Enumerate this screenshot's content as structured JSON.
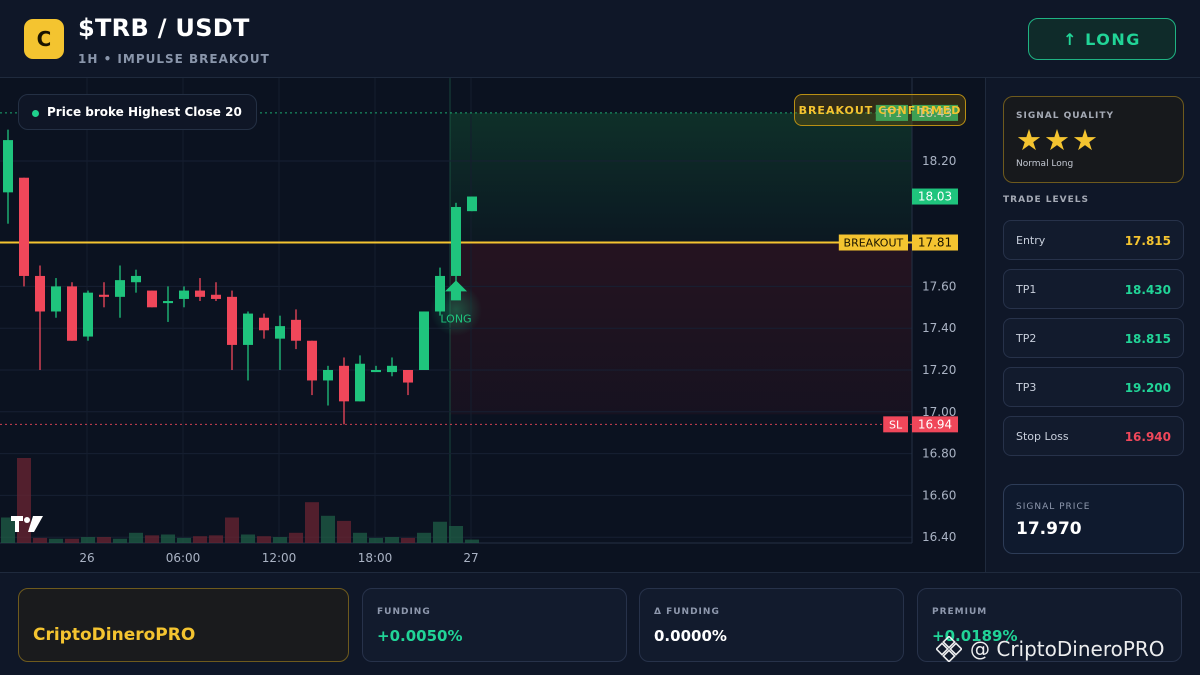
{
  "header": {
    "logo_letter": "C",
    "pair": "$TRB / USDT",
    "subtitle": "1H • IMPULSE BREAKOUT",
    "signal_button": "↑ LONG"
  },
  "chart_overlay": {
    "note": "Price broke Highest Close 20",
    "confirmation": "BREAKOUT CONFIRMED",
    "long_marker_label": "LONG"
  },
  "chart_data": {
    "type": "candlestick",
    "y_ticks": [
      "18.20",
      "17.60",
      "17.40",
      "17.20",
      "17.00",
      "16.80",
      "16.60",
      "16.40"
    ],
    "x_ticks": [
      "26",
      "06:00",
      "12:00",
      "18:00",
      "27"
    ],
    "ylim": [
      16.35,
      18.75
    ],
    "levels": [
      {
        "name": "TP1",
        "value": 18.43,
        "label": "TP1",
        "price_label": "18.43",
        "color": "#1fc47d",
        "style": "dotted"
      },
      {
        "name": "BREAKOUT",
        "value": 17.81,
        "label": "BREAKOUT",
        "price_label": "17.81",
        "color": "#f4c430",
        "style": "solid"
      },
      {
        "name": "SL",
        "value": 16.94,
        "label": "SL",
        "price_label": "16.94",
        "color": "#f0475a",
        "style": "dotted"
      }
    ],
    "last_price": {
      "value": 18.03,
      "label": "18.03"
    },
    "candles": [
      {
        "o": 18.05,
        "h": 18.35,
        "l": 17.9,
        "c": 18.3
      },
      {
        "o": 18.12,
        "h": 18.12,
        "l": 17.6,
        "c": 17.65
      },
      {
        "o": 17.65,
        "h": 17.7,
        "l": 17.2,
        "c": 17.48
      },
      {
        "o": 17.48,
        "h": 17.64,
        "l": 17.45,
        "c": 17.6
      },
      {
        "o": 17.6,
        "h": 17.62,
        "l": 17.34,
        "c": 17.34
      },
      {
        "o": 17.36,
        "h": 17.58,
        "l": 17.34,
        "c": 17.57
      },
      {
        "o": 17.56,
        "h": 17.62,
        "l": 17.5,
        "c": 17.55
      },
      {
        "o": 17.55,
        "h": 17.7,
        "l": 17.45,
        "c": 17.63
      },
      {
        "o": 17.62,
        "h": 17.68,
        "l": 17.57,
        "c": 17.65
      },
      {
        "o": 17.58,
        "h": 17.58,
        "l": 17.5,
        "c": 17.5
      },
      {
        "o": 17.52,
        "h": 17.6,
        "l": 17.43,
        "c": 17.53
      },
      {
        "o": 17.54,
        "h": 17.6,
        "l": 17.5,
        "c": 17.58
      },
      {
        "o": 17.58,
        "h": 17.64,
        "l": 17.53,
        "c": 17.55
      },
      {
        "o": 17.56,
        "h": 17.62,
        "l": 17.53,
        "c": 17.54
      },
      {
        "o": 17.55,
        "h": 17.58,
        "l": 17.2,
        "c": 17.32
      },
      {
        "o": 17.32,
        "h": 17.48,
        "l": 17.15,
        "c": 17.47
      },
      {
        "o": 17.45,
        "h": 17.47,
        "l": 17.35,
        "c": 17.39
      },
      {
        "o": 17.35,
        "h": 17.46,
        "l": 17.2,
        "c": 17.41
      },
      {
        "o": 17.44,
        "h": 17.49,
        "l": 17.3,
        "c": 17.34
      },
      {
        "o": 17.34,
        "h": 17.34,
        "l": 17.08,
        "c": 17.15
      },
      {
        "o": 17.15,
        "h": 17.22,
        "l": 17.03,
        "c": 17.2
      },
      {
        "o": 17.22,
        "h": 17.26,
        "l": 16.94,
        "c": 17.05
      },
      {
        "o": 17.05,
        "h": 17.27,
        "l": 17.05,
        "c": 17.23
      },
      {
        "o": 17.19,
        "h": 17.22,
        "l": 17.2,
        "c": 17.2
      },
      {
        "o": 17.19,
        "h": 17.26,
        "l": 17.17,
        "c": 17.22
      },
      {
        "o": 17.2,
        "h": 17.2,
        "l": 17.08,
        "c": 17.14
      },
      {
        "o": 17.2,
        "h": 17.48,
        "l": 17.2,
        "c": 17.48
      },
      {
        "o": 17.48,
        "h": 17.69,
        "l": 17.46,
        "c": 17.65
      },
      {
        "o": 17.65,
        "h": 18.0,
        "l": 17.6,
        "c": 17.98
      },
      {
        "o": 17.96,
        "h": 18.03,
        "l": 17.96,
        "c": 18.03
      }
    ],
    "volume": [
      0.3,
      1.0,
      0.06,
      0.05,
      0.05,
      0.07,
      0.07,
      0.05,
      0.12,
      0.09,
      0.1,
      0.06,
      0.08,
      0.09,
      0.3,
      0.1,
      0.08,
      0.07,
      0.12,
      0.48,
      0.32,
      0.26,
      0.12,
      0.06,
      0.07,
      0.06,
      0.12,
      0.25,
      0.2,
      0.04
    ]
  },
  "signal_quality": {
    "title": "SIGNAL QUALITY",
    "stars": "★★★",
    "label": "Normal Long"
  },
  "trade_levels": {
    "title": "TRADE LEVELS",
    "items": [
      {
        "name": "Entry",
        "value": "17.815",
        "color": "#f4c430"
      },
      {
        "name": "TP1",
        "value": "18.430",
        "color": "#21d497"
      },
      {
        "name": "TP2",
        "value": "18.815",
        "color": "#21d497"
      },
      {
        "name": "TP3",
        "value": "19.200",
        "color": "#21d497"
      },
      {
        "name": "Stop Loss",
        "value": "16.940",
        "color": "#f0475a"
      }
    ]
  },
  "signal_price": {
    "title": "SIGNAL PRICE",
    "value": "17.970"
  },
  "footer": {
    "brand": "CriptoDineroPRO",
    "funding_label": "FUNDING",
    "funding_value": "+0.0050%",
    "delta_funding_label": "Δ FUNDING",
    "delta_funding_value": "0.0000%",
    "premium_label": "PREMIUM",
    "premium_value": "+0.0189%",
    "watermark": "@ CriptoDineroPRO"
  },
  "colors": {
    "up": "#1fc47d",
    "down": "#f0475a",
    "accent": "#f4c430"
  }
}
